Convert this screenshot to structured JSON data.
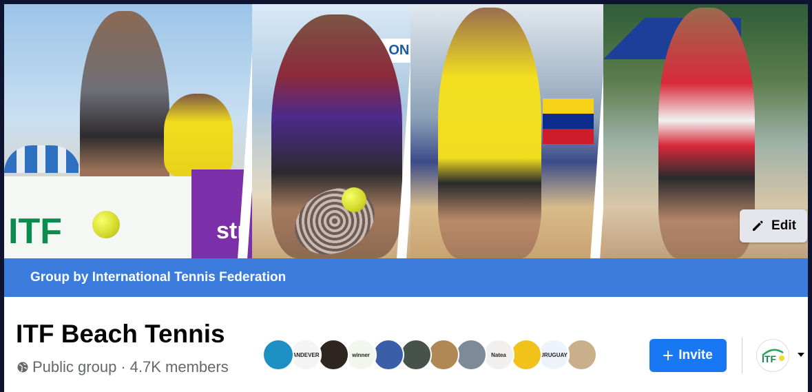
{
  "cover": {
    "edit_label": "Edit"
  },
  "group_strip": {
    "text": "Group by International Tennis Federation"
  },
  "group": {
    "title": "ITF Beach Tennis",
    "privacy": "Public group",
    "separator": "·",
    "members": "4.7K members"
  },
  "member_avatars": [
    {
      "label": "",
      "color": "#1e8fc2"
    },
    {
      "label": "ANDEVER",
      "color": "#f4f4f4"
    },
    {
      "label": "",
      "color": "#2e2420"
    },
    {
      "label": "winner",
      "color": "#f3f6ee"
    },
    {
      "label": "",
      "color": "#3a5fa8"
    },
    {
      "label": "",
      "color": "#47524a"
    },
    {
      "label": "",
      "color": "#b08855"
    },
    {
      "label": "",
      "color": "#7e8a98"
    },
    {
      "label": "Natea",
      "color": "#f2f0ee"
    },
    {
      "label": "",
      "color": "#f1c21a"
    },
    {
      "label": "URUGUAY",
      "color": "#eef3fb"
    },
    {
      "label": "",
      "color": "#c9b08a"
    }
  ],
  "actions": {
    "invite_label": "Invite",
    "invite_icon": "plus-icon",
    "profile_icon": "itf-logo-avatar",
    "caret_icon": "caret-down-icon"
  },
  "colors": {
    "accent": "#1877f2",
    "strip": "#3a7bdb",
    "border": "#0e1330"
  }
}
